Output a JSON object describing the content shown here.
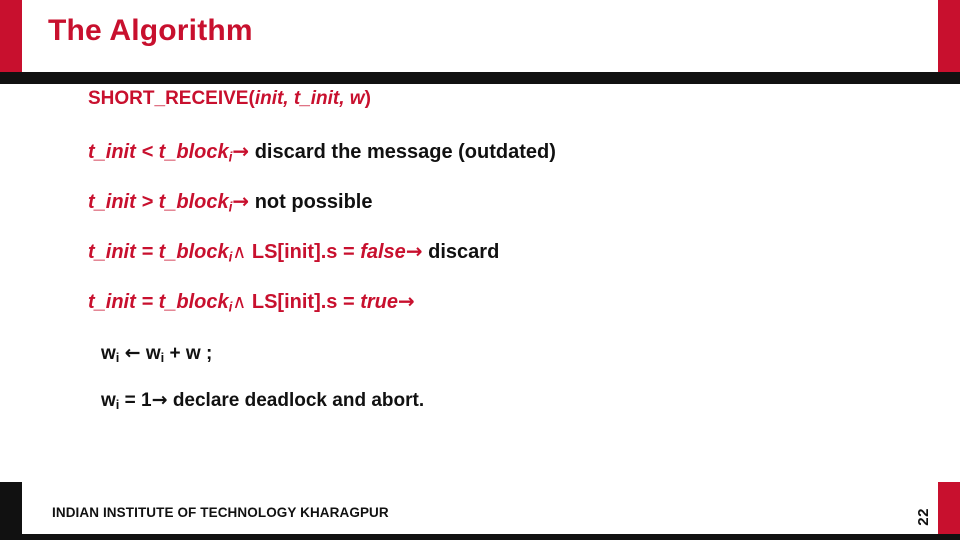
{
  "slide": {
    "title": "The Algorithm",
    "page_number": "22",
    "footer": "INDIAN INSTITUTE OF TECHNOLOGY KHARAGPUR",
    "accent_color": "#c8102e",
    "dark_color": "#111111",
    "body_color": "#c8102e"
  },
  "content": {
    "heading": {
      "name": "SHORT_RECEIVE(",
      "args": "init, t_init, w",
      "close": ")"
    },
    "lines": [
      {
        "id": "line-1",
        "lhs": "t_init < t_block",
        "sub": "i",
        "arrow": "→",
        "rhs": "discard the message (outdated)"
      },
      {
        "id": "line-2",
        "lhs": "t_init > t_block",
        "sub": "i",
        "arrow": "→",
        "rhs": "not possible"
      },
      {
        "id": "line-3",
        "lhs": "t_init = t_block",
        "sub": "i",
        "conj": "∧",
        "mid": "LS[init].s =",
        "value": "false",
        "arrow": "→",
        "rhs": "discard"
      },
      {
        "id": "line-4",
        "lhs": "t_init = t_block",
        "sub": "i",
        "conj": "∧",
        "mid": "LS[init].s =",
        "value": "true",
        "arrow": "→",
        "rhs": ""
      },
      {
        "id": "line-5",
        "text_a": "w",
        "sub_a": "i",
        "assign": "←",
        "text_b": "w",
        "sub_b": "i",
        "text_c": "+ w ;"
      },
      {
        "id": "line-6",
        "text_a": "w",
        "sub_a": "i",
        "text_b": "= 1",
        "arrow": "→",
        "text_c": "declare deadlock and abort."
      }
    ]
  }
}
